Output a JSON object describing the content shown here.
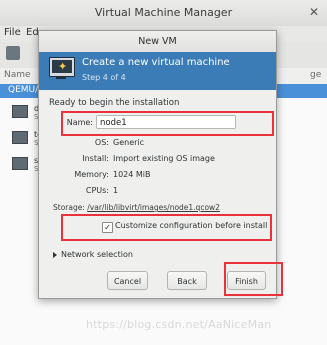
{
  "background_window": {
    "title": "Virtual Machine Manager",
    "close_glyph": "✕",
    "menu": [
      "File",
      "Ed"
    ],
    "column_name": "Name",
    "column_usage": "ge",
    "group_label": "QEMU/K",
    "vms": [
      {
        "name": "de",
        "state": "Sh"
      },
      {
        "name": "te",
        "state": "Sh"
      },
      {
        "name": "se",
        "state": "Sh"
      }
    ]
  },
  "dialog": {
    "title": "New VM",
    "header_title": "Create a new virtual machine",
    "header_step": "Step 4 of 4",
    "ready_text": "Ready to begin the installation",
    "name_label": "Name:",
    "name_value": "node1",
    "os_label": "OS:",
    "os_value": "Generic",
    "install_label": "Install:",
    "install_value": "Import existing OS image",
    "memory_label": "Memory:",
    "memory_value": "1024 MiB",
    "cpus_label": "CPUs:",
    "cpus_value": "1",
    "storage_label": "Storage:",
    "storage_path": "/var/lib/libvirt/images/node1.qcow2",
    "customize_label": "Customize configuration before install",
    "customize_checked": true,
    "customize_check_glyph": "✓",
    "network_selection_label": "Network selection",
    "buttons": {
      "cancel": "Cancel",
      "back": "Back",
      "finish": "Finish"
    }
  },
  "watermark": "https://blog.csdn.net/AaNiceMan",
  "colors": {
    "header_blue": "#3c7cb6",
    "highlight_red": "#e8333a",
    "group_blue": "#4a90d9"
  },
  "icons": [
    "monitor-new-vm-icon",
    "checkbox-check-icon",
    "expander-arrow-icon",
    "vm-monitor-icon"
  ]
}
